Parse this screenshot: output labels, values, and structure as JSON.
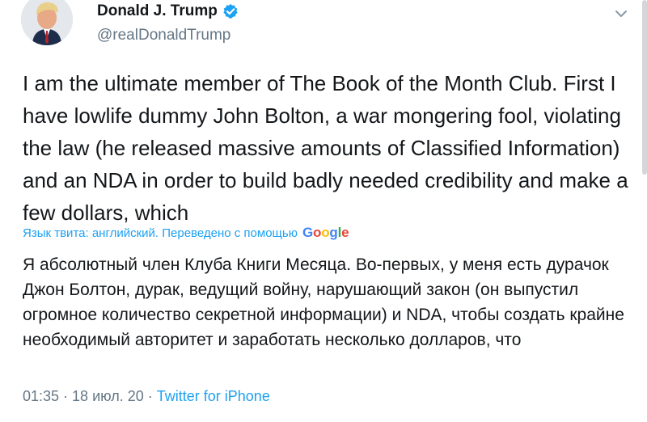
{
  "author": {
    "display_name": "Donald J. Trump",
    "handle": "@realDonaldTrump",
    "verified_icon": "verified-badge-icon",
    "avatar_icon": "avatar-photo"
  },
  "header": {
    "more_icon": "chevron-down-icon"
  },
  "tweet": {
    "text": "I am the ultimate member of The Book of the Month Club. First I have lowlife dummy John Bolton, a war mongering fool, violating the law (he released massive amounts of Classified Information) and an NDA in order to build badly needed credibility and make a few dollars, which"
  },
  "translation": {
    "label": "Язык твита: английский. Переведено с помощью",
    "provider_logo": "Google",
    "text": "Я абсолютный член Клуба Книги Месяца. Во-первых, у меня есть дурачок Джон Болтон, дурак, ведущий войну, нарушающий закон (он выпустил огромное количество секретной информации) и NDA, чтобы создать крайне необходимый авторитет и заработать несколько долларов, что"
  },
  "meta": {
    "time": "01:35",
    "separator": " · ",
    "date": "18 июл. 20",
    "source": "Twitter for iPhone"
  },
  "colors": {
    "accent": "#1da1f2",
    "text": "#14171a",
    "secondary_text": "#657786"
  }
}
